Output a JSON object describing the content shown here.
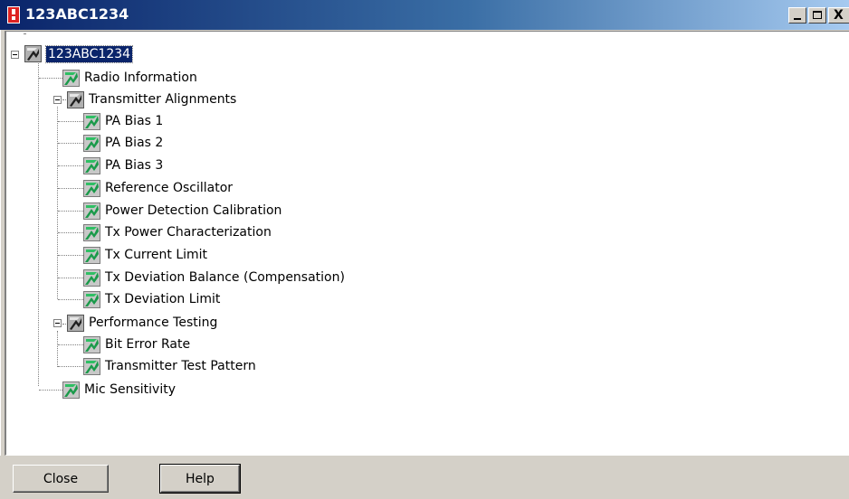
{
  "window": {
    "title": "123ABC1234",
    "icon": "radio-app-icon",
    "controls": {
      "minimize": "_",
      "maximize": "□",
      "close": "X"
    }
  },
  "tree": {
    "root": {
      "label": "123ABC1234",
      "icon": "alignment-gray-icon",
      "selected": true
    },
    "items": [
      {
        "label": "Radio Information",
        "icon": "alignment-green-icon"
      },
      {
        "label": "Transmitter Alignments",
        "icon": "alignment-gray-icon",
        "children": [
          {
            "label": "PA Bias 1"
          },
          {
            "label": "PA Bias 2"
          },
          {
            "label": "PA Bias 3"
          },
          {
            "label": "Reference Oscillator"
          },
          {
            "label": "Power Detection Calibration"
          },
          {
            "label": "Tx Power Characterization"
          },
          {
            "label": "Tx Current Limit"
          },
          {
            "label": "Tx Deviation Balance (Compensation)"
          },
          {
            "label": "Tx Deviation Limit"
          }
        ]
      },
      {
        "label": "Performance Testing",
        "icon": "alignment-gray-icon",
        "children": [
          {
            "label": "Bit Error Rate"
          },
          {
            "label": "Transmitter Test Pattern"
          }
        ]
      },
      {
        "label": "Mic Sensitivity",
        "icon": "alignment-green-icon"
      }
    ]
  },
  "footer": {
    "close_label": "Close",
    "help_label": "Help"
  },
  "colors": {
    "titlebar_start": "#0a246a",
    "titlebar_end": "#a6caf0",
    "dialog_face": "#d4d0c8",
    "icon_green": "#1a9a4a",
    "icon_gray": "#7a7a7a",
    "selection": "#0a246a"
  }
}
